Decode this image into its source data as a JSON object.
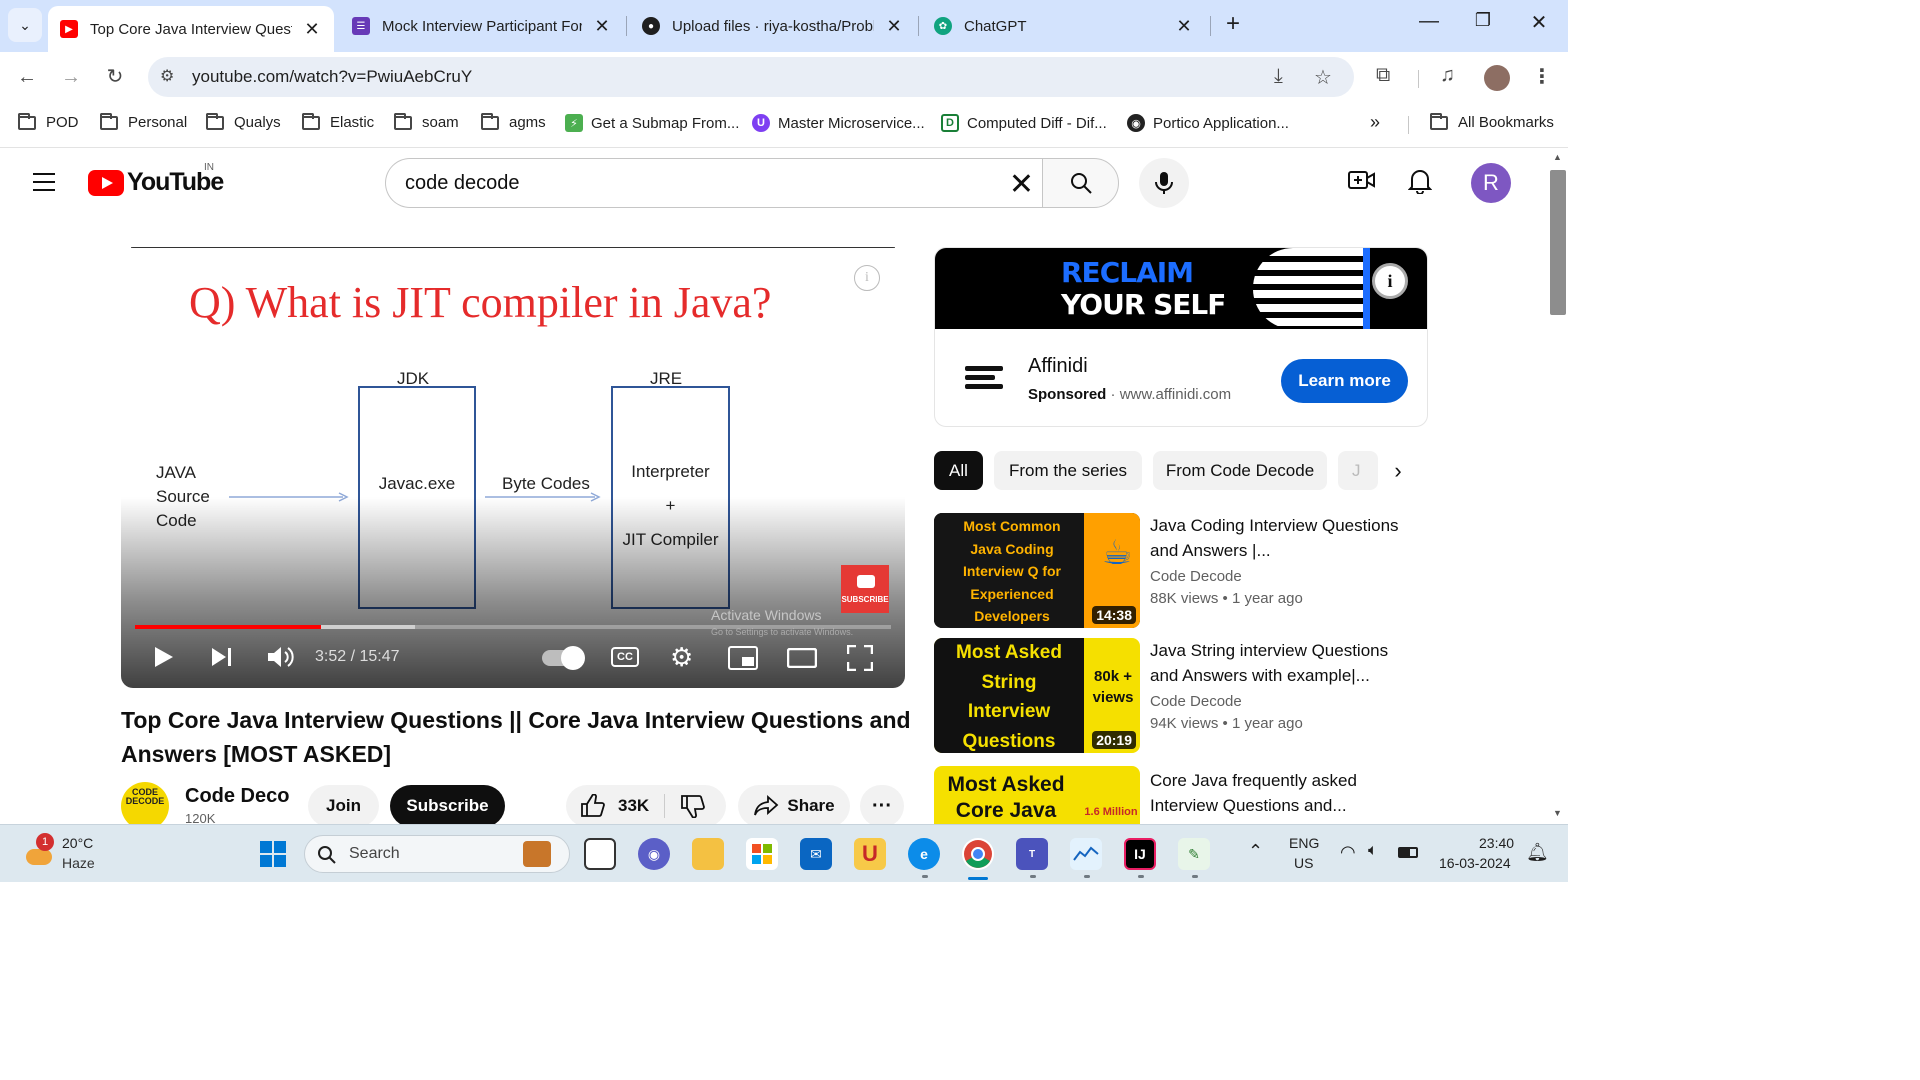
{
  "browser": {
    "tabs": [
      {
        "title": "Top Core Java Interview Questio",
        "active": true,
        "icon": "youtube-icon",
        "color": "#ff0000"
      },
      {
        "title": "Mock Interview Participant Form",
        "active": false,
        "icon": "forms-icon",
        "color": "#673ab7"
      },
      {
        "title": "Upload files · riya-kostha/Proble",
        "active": false,
        "icon": "github-icon",
        "color": "#1f1f1f"
      },
      {
        "title": "ChatGPT",
        "active": false,
        "icon": "chatgpt-icon",
        "color": "#10a37f"
      }
    ],
    "url": "youtube.com/watch?v=PwiuAebCruY",
    "bookmarks": [
      {
        "label": "POD",
        "type": "folder"
      },
      {
        "label": "Personal",
        "type": "folder"
      },
      {
        "label": "Qualys",
        "type": "folder"
      },
      {
        "label": "Elastic",
        "type": "folder"
      },
      {
        "label": "soam",
        "type": "folder"
      },
      {
        "label": "agms",
        "type": "folder"
      },
      {
        "label": "Get a Submap From...",
        "type": "site",
        "color": "#4caf50",
        "glyph": "⚡"
      },
      {
        "label": "Master Microservice...",
        "type": "site",
        "color": "#7e3ff2",
        "glyph": "U"
      },
      {
        "label": "Computed Diff - Dif...",
        "type": "site",
        "color": "#1a7f37",
        "glyph": "D"
      },
      {
        "label": "Portico Application...",
        "type": "site",
        "color": "#222",
        "glyph": "◉"
      }
    ],
    "all_bookmarks": "All Bookmarks",
    "more_bookmarks": "»"
  },
  "youtube": {
    "country": "IN",
    "logo_text": "YouTube",
    "search_value": "code decode",
    "avatar_letter": "R"
  },
  "player": {
    "slide_title": "Q)  What is JIT compiler in Java?",
    "diagram": {
      "source": [
        "JAVA",
        "Source",
        "Code"
      ],
      "jdk_label": "JDK",
      "jdk_box": "Javac.exe",
      "arrow_label": "Byte Codes",
      "jre_label": "JRE",
      "jre_box": [
        "Interpreter",
        "+",
        "JIT Compiler"
      ]
    },
    "watermark": "SUBSCRIBE",
    "activate_title": "Activate Windows",
    "activate_sub": "Go to Settings to activate Windows.",
    "time": "3:52 / 15:47",
    "played_fraction": 0.2457,
    "buffered_fraction": 0.37,
    "cc": "CC"
  },
  "video": {
    "title": "Top Core Java Interview Questions || Core Java Interview Questions and Answers [MOST ASKED]",
    "channel": "Code Deco",
    "channel_avatar": "CODE DECODE",
    "subs": "120K",
    "join": "Join",
    "subscribe": "Subscribe",
    "likes": "33K",
    "share": "Share",
    "more": "···"
  },
  "ad": {
    "line1": "RECLAIM",
    "line2": "YOUR SELF",
    "advertiser": "Affinidi",
    "sponsored": "Sponsored",
    "domain": "www.affinidi.com",
    "cta": "Learn more"
  },
  "chips": [
    "All",
    "From the series",
    "From Code Decode",
    "J"
  ],
  "recommended": [
    {
      "thumb_lines": [
        "Most Common",
        "Java Coding",
        "Interview Q for",
        "Experienced",
        "Developers"
      ],
      "thumb_bg": "#1a1a1a",
      "thumb_fg": "#ffb300",
      "duration": "14:38",
      "title": "Java Coding Interview Questions and Answers |...",
      "channel": "Code Decode",
      "meta": "88K views  •  1 year ago"
    },
    {
      "thumb_lines": [
        "Most Asked",
        "String",
        "Interview",
        "Questions"
      ],
      "thumb_bg": "#f5e000",
      "thumb_fg": "#111",
      "badge": "80k + views",
      "duration": "20:19",
      "title": "Java String interview Questions and Answers with example|...",
      "channel": "Code Decode",
      "meta": "94K views  •  1 year ago"
    },
    {
      "thumb_lines": [
        "Most Asked",
        "Core Java"
      ],
      "thumb_bg": "#f5e000",
      "thumb_fg": "#111",
      "badge": "1.6 Million",
      "title": "Core Java frequently asked Interview Questions and...",
      "channel": "",
      "meta": ""
    }
  ],
  "taskbar": {
    "weather_temp": "20°C",
    "weather_desc": "Haze",
    "weather_badge": "1",
    "search": "Search",
    "lang1": "ENG",
    "lang2": "US",
    "time": "23:40",
    "date": "16-03-2024"
  }
}
